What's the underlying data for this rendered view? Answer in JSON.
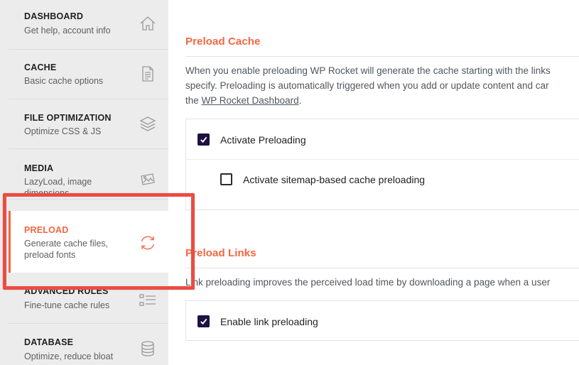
{
  "sidebar": {
    "items": [
      {
        "title": "DASHBOARD",
        "sub": "Get help, account info",
        "icon": "home-icon"
      },
      {
        "title": "CACHE",
        "sub": "Basic cache options",
        "icon": "document-icon"
      },
      {
        "title": "FILE OPTIMIZATION",
        "sub": "Optimize CSS & JS",
        "icon": "layers-icon"
      },
      {
        "title": "MEDIA",
        "sub": "LazyLoad, image dimensions",
        "icon": "images-icon"
      },
      {
        "title": "PRELOAD",
        "sub": "Generate cache files, preload fonts",
        "icon": "refresh-icon",
        "active": true
      },
      {
        "title": "ADVANCED RULES",
        "sub": "Fine-tune cache rules",
        "icon": "list-icon"
      },
      {
        "title": "DATABASE",
        "sub": "Optimize, reduce bloat",
        "icon": "database-icon"
      }
    ]
  },
  "preload_cache": {
    "title": "Preload Cache",
    "desc_line1": "When you enable preloading WP Rocket will generate the cache starting with the links",
    "desc_line2": "specify. Preloading is automatically triggered when you add or update content and car",
    "desc_line3_prefix": "the ",
    "desc_link": "WP Rocket Dashboard",
    "desc_line3_suffix": ".",
    "options": [
      {
        "label": "Activate Preloading",
        "checked": true
      },
      {
        "label": "Activate sitemap-based cache preloading",
        "checked": false
      }
    ]
  },
  "preload_links": {
    "title": "Preload Links",
    "desc": "Link preloading improves the perceived load time by downloading a page when a user",
    "options": [
      {
        "label": "Enable link preloading",
        "checked": true
      }
    ]
  },
  "colors": {
    "accent": "#f56640",
    "checkbox": "#1f1142",
    "highlight": "#ec4c41",
    "sidebar_bg": "#ececec"
  }
}
